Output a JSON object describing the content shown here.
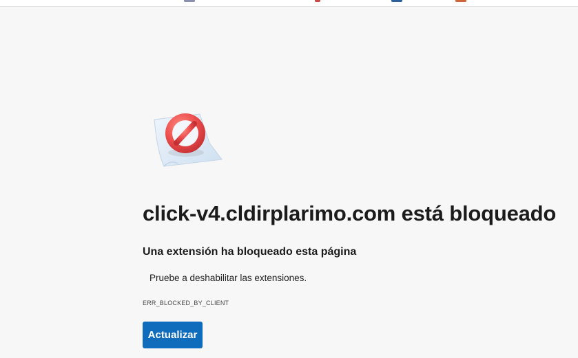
{
  "error_page": {
    "heading": "click-v4.cldirplarimo.com está bloqueado",
    "subheading": "Una extensión ha bloqueado esta página",
    "suggestion": "Pruebe a deshabilitar las extensiones.",
    "error_code": "ERR_BLOCKED_BY_CLIENT",
    "refresh_label": "Actualizar",
    "illustration_icon": "blocked-sign-icon"
  },
  "colors": {
    "background": "#f7f7f7",
    "button": "#0f6cbd",
    "button_text": "#ffffff",
    "sign_red": "#e84b4b",
    "paper": "#dbe8f5"
  }
}
